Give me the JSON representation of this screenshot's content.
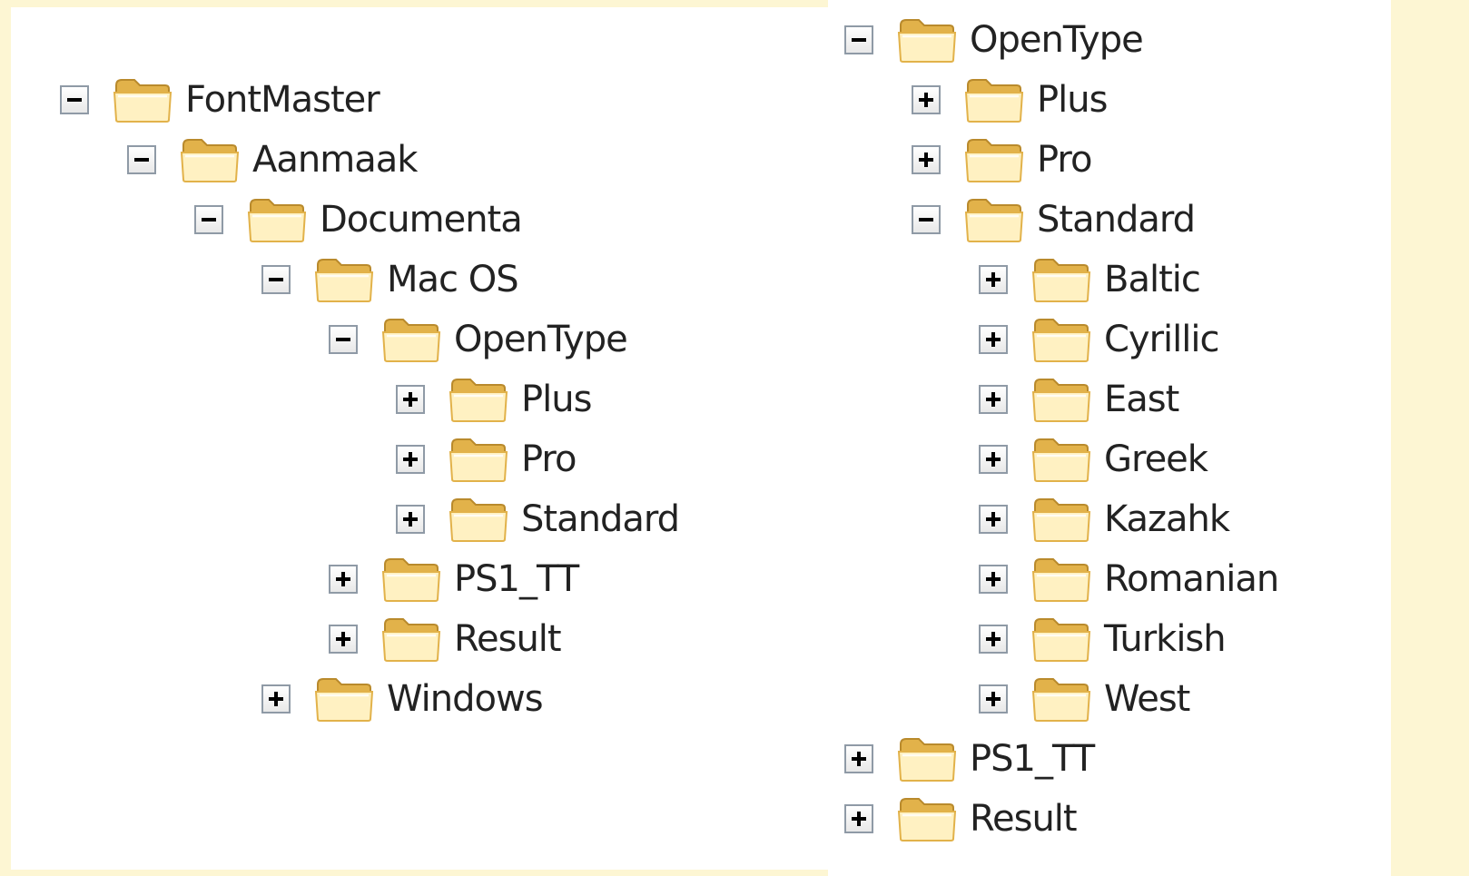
{
  "colors": {
    "background": "#fdf6d3",
    "panel": "#ffffff",
    "folder_light": "#fff1c2",
    "folder_dark": "#e2b24a",
    "text": "#222222"
  },
  "icons": {
    "folder": "folder-icon",
    "expand": "plus-box-icon",
    "collapse": "minus-box-icon"
  },
  "left_tree": [
    {
      "label": "FontMaster",
      "depth": 0,
      "state": "expanded"
    },
    {
      "label": "Aanmaak",
      "depth": 1,
      "state": "expanded"
    },
    {
      "label": "Documenta",
      "depth": 2,
      "state": "expanded"
    },
    {
      "label": "Mac OS",
      "depth": 3,
      "state": "expanded"
    },
    {
      "label": "OpenType",
      "depth": 4,
      "state": "expanded"
    },
    {
      "label": "Plus",
      "depth": 5,
      "state": "collapsed"
    },
    {
      "label": "Pro",
      "depth": 5,
      "state": "collapsed"
    },
    {
      "label": "Standard",
      "depth": 5,
      "state": "collapsed"
    },
    {
      "label": "PS1_TT",
      "depth": 4,
      "state": "collapsed"
    },
    {
      "label": "Result",
      "depth": 4,
      "state": "collapsed"
    },
    {
      "label": "Windows",
      "depth": 3,
      "state": "collapsed"
    }
  ],
  "right_tree": [
    {
      "label": "OpenType",
      "depth": 0,
      "state": "expanded"
    },
    {
      "label": "Plus",
      "depth": 1,
      "state": "collapsed"
    },
    {
      "label": "Pro",
      "depth": 1,
      "state": "collapsed"
    },
    {
      "label": "Standard",
      "depth": 1,
      "state": "expanded"
    },
    {
      "label": "Baltic",
      "depth": 2,
      "state": "collapsed"
    },
    {
      "label": "Cyrillic",
      "depth": 2,
      "state": "collapsed"
    },
    {
      "label": "East",
      "depth": 2,
      "state": "collapsed"
    },
    {
      "label": "Greek",
      "depth": 2,
      "state": "collapsed"
    },
    {
      "label": "Kazahk",
      "depth": 2,
      "state": "collapsed"
    },
    {
      "label": "Romanian",
      "depth": 2,
      "state": "collapsed"
    },
    {
      "label": "Turkish",
      "depth": 2,
      "state": "collapsed"
    },
    {
      "label": "West",
      "depth": 2,
      "state": "collapsed"
    },
    {
      "label": "PS1_TT",
      "depth": 0,
      "state": "collapsed"
    },
    {
      "label": "Result",
      "depth": 0,
      "state": "collapsed"
    }
  ]
}
